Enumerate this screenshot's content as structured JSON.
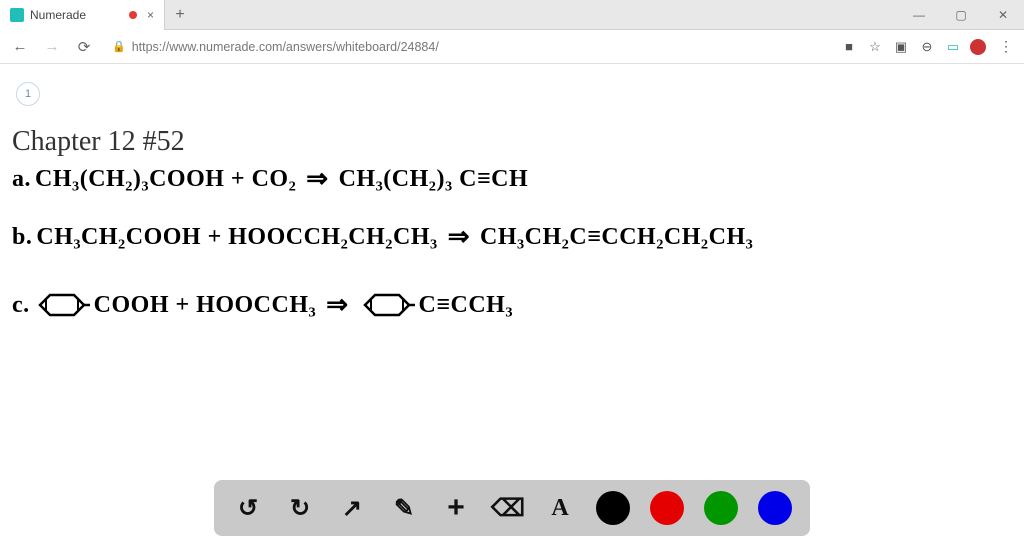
{
  "browser": {
    "tab_title": "Numerade",
    "new_tab": "+",
    "close_tab": "×",
    "win_min": "—",
    "win_max": "▢",
    "win_close": "✕",
    "nav_back": "←",
    "nav_fwd": "→",
    "nav_reload": "⟳",
    "lock": "🔒",
    "url": "https://www.numerade.com/answers/whiteboard/24884/",
    "ext_camera": "■",
    "ext_star": "☆",
    "ext_box": "▣",
    "ext_print": "⊖",
    "ext_screen": "▭",
    "menu": "⋮"
  },
  "page": {
    "indicator": "1",
    "heading": "Chapter 12 #52"
  },
  "chem": {
    "a_label": "a.",
    "a_left": "CH₃(CH₂)₃COOH + CO₂",
    "a_right": "CH₃(CH₂)₃ C≡CH",
    "b_label": "b.",
    "b_left": "CH₃CH₂COOH + HOOCCH₂CH₂CH₃",
    "b_right": "CH₃CH₂C≡CCH₂CH₂CH₃",
    "c_label": "c.",
    "c_mid": "COOH + HOOCCH₃",
    "c_right": "C≡CCH₃",
    "arrow": "⇒"
  },
  "toolbar": {
    "undo": "↺",
    "redo": "↻",
    "pointer": "↖",
    "pen": "✎",
    "add": "+",
    "eraser": "⌫",
    "text": "A"
  },
  "colors": {
    "black": "#000000",
    "red": "#e40000",
    "green": "#009600",
    "blue": "#0000e8"
  }
}
